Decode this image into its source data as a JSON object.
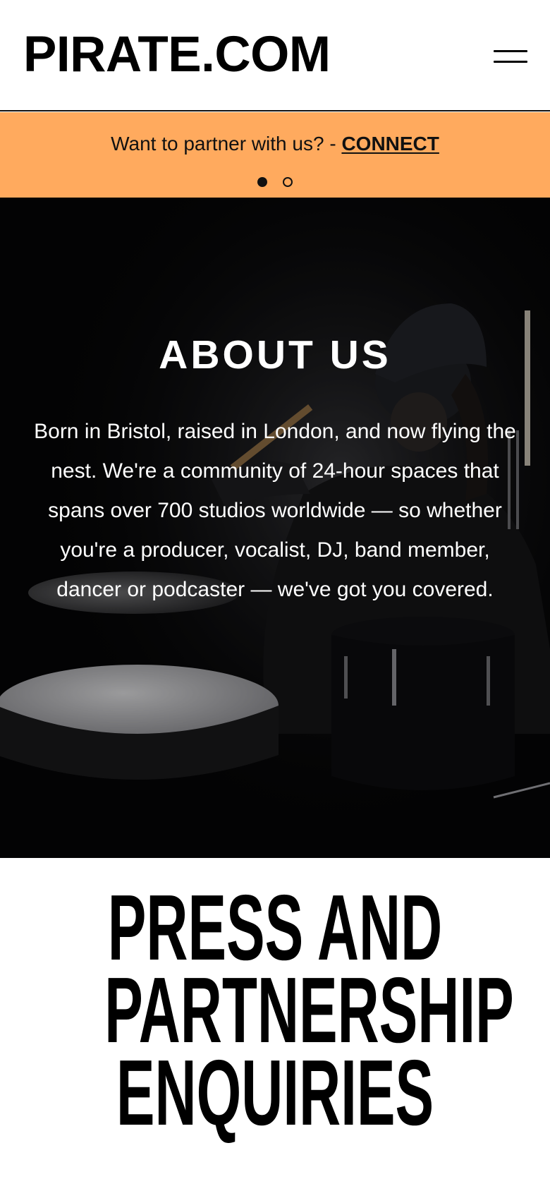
{
  "header": {
    "logo_text": "PIRATE.COM",
    "menu_icon": "hamburger-menu-icon"
  },
  "banner": {
    "text": "Want to partner with us? - ",
    "link_label": "CONNECT",
    "background_color": "#ffaa5e",
    "slides_total": 2,
    "active_slide": 1
  },
  "about": {
    "title": "ABOUT US",
    "body": "Born in Bristol, raised in London, and now flying the nest. We're a community of 24-hour spaces that spans over 700 studios worldwide — so whether you're a producer, vocalist, DJ, band member, dancer or podcaster — we've got you covered.",
    "background_image": "drummer-playing-drums-photo"
  },
  "press": {
    "title": "PRESS AND PARTNERSHIP ENQUIRIES"
  }
}
